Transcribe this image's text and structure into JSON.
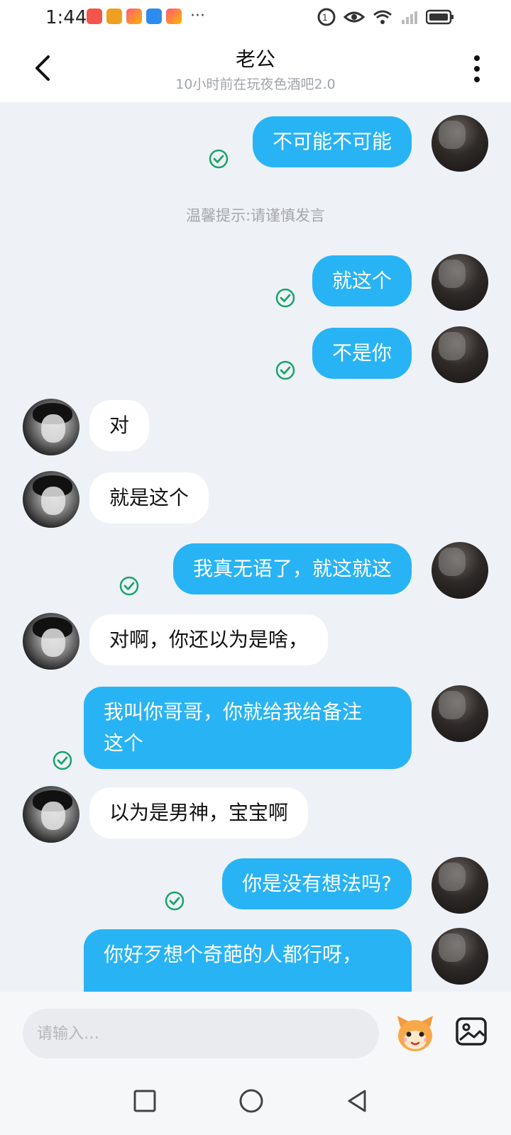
{
  "status_bar": {
    "time": "1:44",
    "more": "···"
  },
  "header": {
    "title": "老公",
    "subtitle": "10小时前在玩夜色酒吧2.0"
  },
  "messages": [
    {
      "sender": "me",
      "text": "不可能不可能",
      "status": "delivered"
    },
    {
      "type": "tip",
      "text": "温馨提示:请谨慎发言"
    },
    {
      "sender": "me",
      "text": "就这个",
      "status": "delivered"
    },
    {
      "sender": "me",
      "text": "不是你",
      "status": "delivered"
    },
    {
      "sender": "other",
      "text": "对"
    },
    {
      "sender": "other",
      "text": "就是这个"
    },
    {
      "sender": "me",
      "text": "我真无语了，就这就这",
      "status": "delivered"
    },
    {
      "sender": "other",
      "text": "对啊，你还以为是啥，"
    },
    {
      "sender": "me",
      "text": "我叫你哥哥，你就给我给备注\n这个",
      "status": "delivered"
    },
    {
      "sender": "other",
      "text": "以为是男神，宝宝啊"
    },
    {
      "sender": "me",
      "text": "你是没有想法吗?",
      "status": "delivered"
    },
    {
      "sender": "me",
      "text": "你好歹想个奇葩的人都行呀，",
      "status": "delivered"
    }
  ],
  "input": {
    "placeholder": "请输入…"
  },
  "colors": {
    "my_bubble": "#28b3f5",
    "other_bubble": "#ffffff",
    "check": "#1aa36b",
    "background": "#eef1f6"
  },
  "icons": {
    "back": "chevron-left-icon",
    "more": "more-vertical-icon",
    "emoji": "emoji-mascot-icon",
    "image": "image-icon",
    "nav_recent": "square-icon",
    "nav_home": "circle-icon",
    "nav_back": "triangle-back-icon"
  }
}
